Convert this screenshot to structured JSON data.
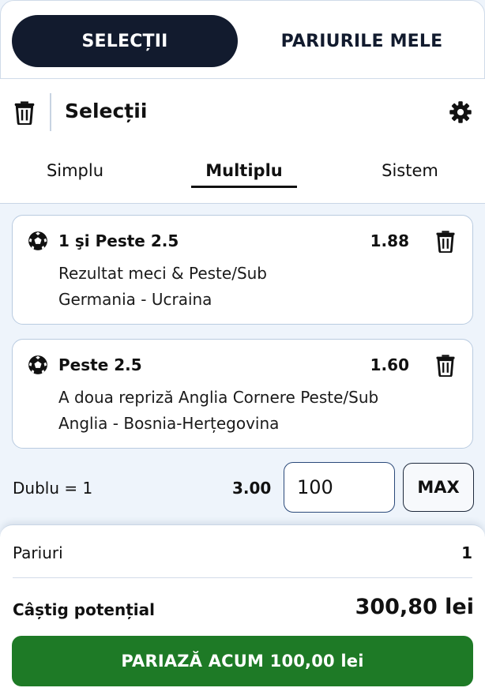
{
  "tabs": {
    "active": "SELECȚII",
    "inactive": "PARIURILE MELE"
  },
  "header": {
    "title": "Selecții",
    "trash_icon": "trash-icon",
    "settings_icon": "gear-icon"
  },
  "bet_types": [
    "Simplu",
    "Multiplu",
    "Sistem"
  ],
  "selected_bet_type": "Multiplu",
  "selections": [
    {
      "pick": "1 şi Peste 2.5",
      "odd": "1.88",
      "market": "Rezultat meci & Peste/Sub",
      "event": "Germania - Ucraina",
      "icon": "soccer-ball-icon"
    },
    {
      "pick": "Peste 2.5",
      "odd": "1.60",
      "market": "A doua repriză Anglia Cornere Peste/Sub",
      "event": "Anglia - Bosnia-Herțegovina",
      "icon": "soccer-ball-icon"
    }
  ],
  "stake": {
    "label": "Dublu = 1",
    "odd": "3.00",
    "value": "100",
    "max_label": "MAX"
  },
  "summary": {
    "bets_label": "Pariuri",
    "bets_value": "1",
    "win_label": "Câștig potențial",
    "win_value": "300,80 lei",
    "cta": "PARIAZĂ ACUM 100,00 lei"
  },
  "colors": {
    "dark": "#121b2e",
    "cta_green": "#1e7a26",
    "border": "#b9cbe0",
    "background": "#eef4fb"
  }
}
